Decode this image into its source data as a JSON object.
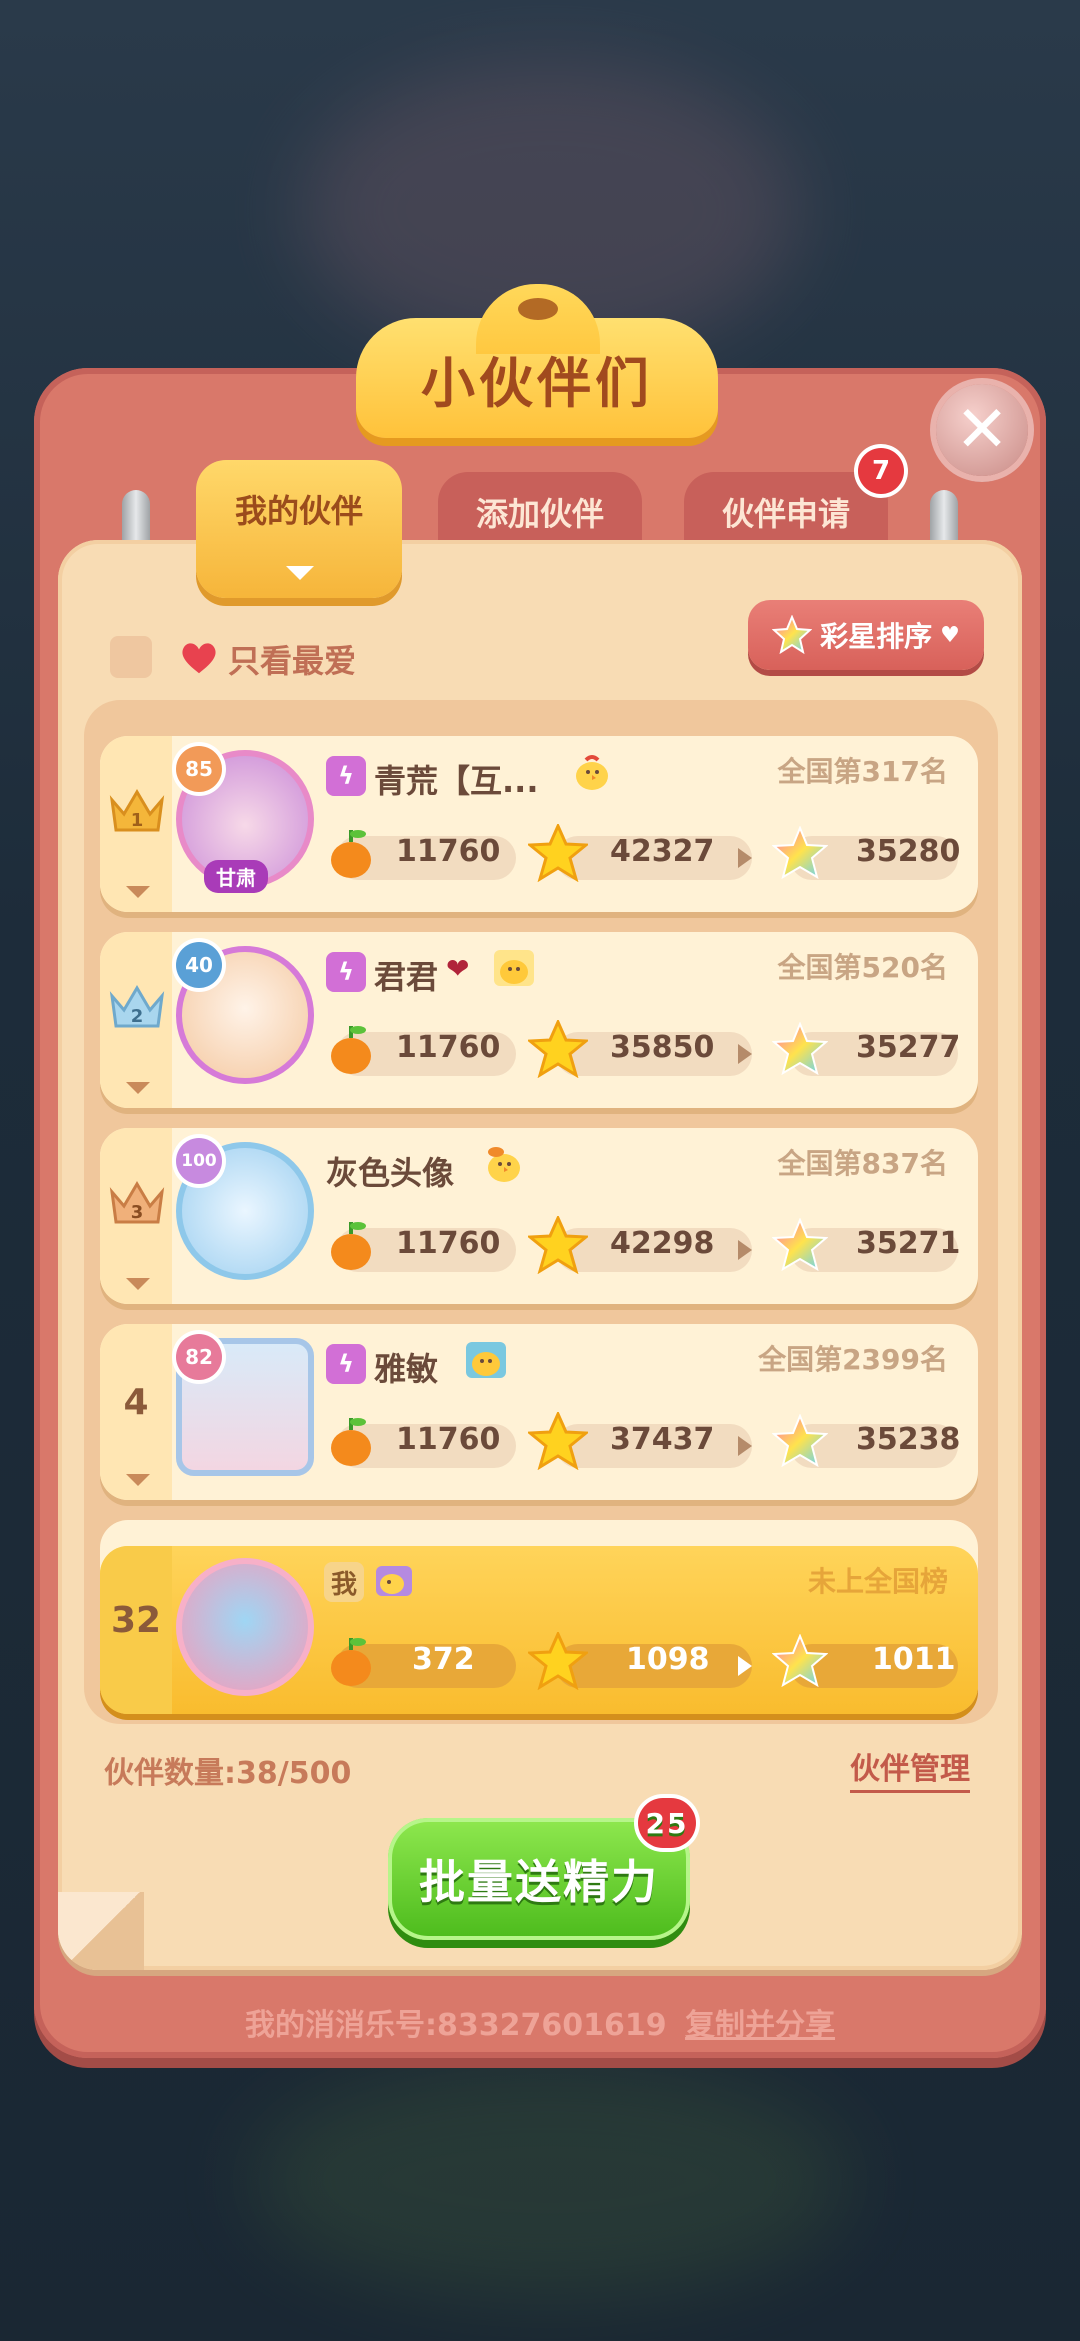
{
  "title": "小伙伴们",
  "tabs": [
    {
      "label": "我的伙伴"
    },
    {
      "label": "添加伙伴"
    },
    {
      "label": "伙伴申请",
      "badge": "7"
    }
  ],
  "filter": {
    "only_favorites_label": "只看最爱",
    "checked": false
  },
  "sort_button": {
    "label": "彩星排序",
    "icon": "rainbow-star-icon"
  },
  "partners": [
    {
      "rank": "1",
      "level": "85",
      "region": "甘肃",
      "name": "青荒【互...",
      "national_rank": "全国第317名",
      "fruit": "11760",
      "stars": "42327",
      "rainbow_stars": "35280"
    },
    {
      "rank": "2",
      "level": "40",
      "name": "君君",
      "national_rank": "全国第520名",
      "fruit": "11760",
      "stars": "35850",
      "rainbow_stars": "35277"
    },
    {
      "rank": "3",
      "level": "100",
      "name": "灰色头像",
      "national_rank": "全国第837名",
      "fruit": "11760",
      "stars": "42298",
      "rainbow_stars": "35271"
    },
    {
      "rank": "4",
      "level": "82",
      "name": "雅敏",
      "national_rank": "全国第2399名",
      "fruit": "11760",
      "stars": "37437",
      "rainbow_stars": "35238"
    }
  ],
  "me": {
    "rank": "32",
    "name": "我",
    "national_rank": "未上全国榜",
    "fruit": "372",
    "stars": "1098",
    "rainbow_stars": "1011"
  },
  "partner_count": "伙伴数量:38/500",
  "manage_label": "伙伴管理",
  "send_button": {
    "label": "批量送精力",
    "badge": "25"
  },
  "footer": {
    "account": "我的消消乐号:83327601619",
    "copy_share": "复制并分享"
  },
  "colors": {
    "panel": "#d9786a",
    "paper": "#f8dcb4",
    "accent_yellow": "#ffc23a",
    "green": "#4cbb1c",
    "badge_red": "#e5393f"
  }
}
